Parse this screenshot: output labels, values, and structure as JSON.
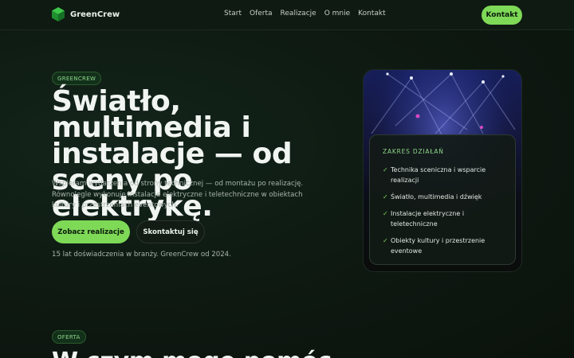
{
  "header": {
    "brand": "GreenCrew",
    "nav": [
      "Start",
      "Oferta",
      "Realizacje",
      "O mnie",
      "Kontakt"
    ],
    "cta": "Kontakt"
  },
  "hero": {
    "eyebrow": "GREENCREW",
    "title": "Światło, multimedia i instalacje — od sceny po elektrykę.",
    "description": "Wspieram wydarzenia od strony technicznej — od montażu po realizację. Równolegle wykonuję instalacje elektryczne i teletechniczne w obiektach kultury i przestrzeniach eventowych.",
    "primary_button": "Zobacz realizacje",
    "secondary_button": "Skontaktuj się",
    "experience": "15 lat doświadczenia w branży. GreenCrew od 2024."
  },
  "scope": {
    "title": "ZAKRES DZIAŁAŃ",
    "items": [
      "Technika sceniczna i wsparcie realizacji",
      "Światło, multimedia i dźwięk",
      "Instalacje elektryczne i teletechniczne",
      "Obiekty kultury i przestrzenie eventowe"
    ]
  },
  "offer": {
    "eyebrow": "OFERTA",
    "title": "W czym mogę pomóc"
  },
  "colors": {
    "accent": "#7ed957",
    "background": "#0e1a12",
    "pill_text": "#8fd68a"
  }
}
